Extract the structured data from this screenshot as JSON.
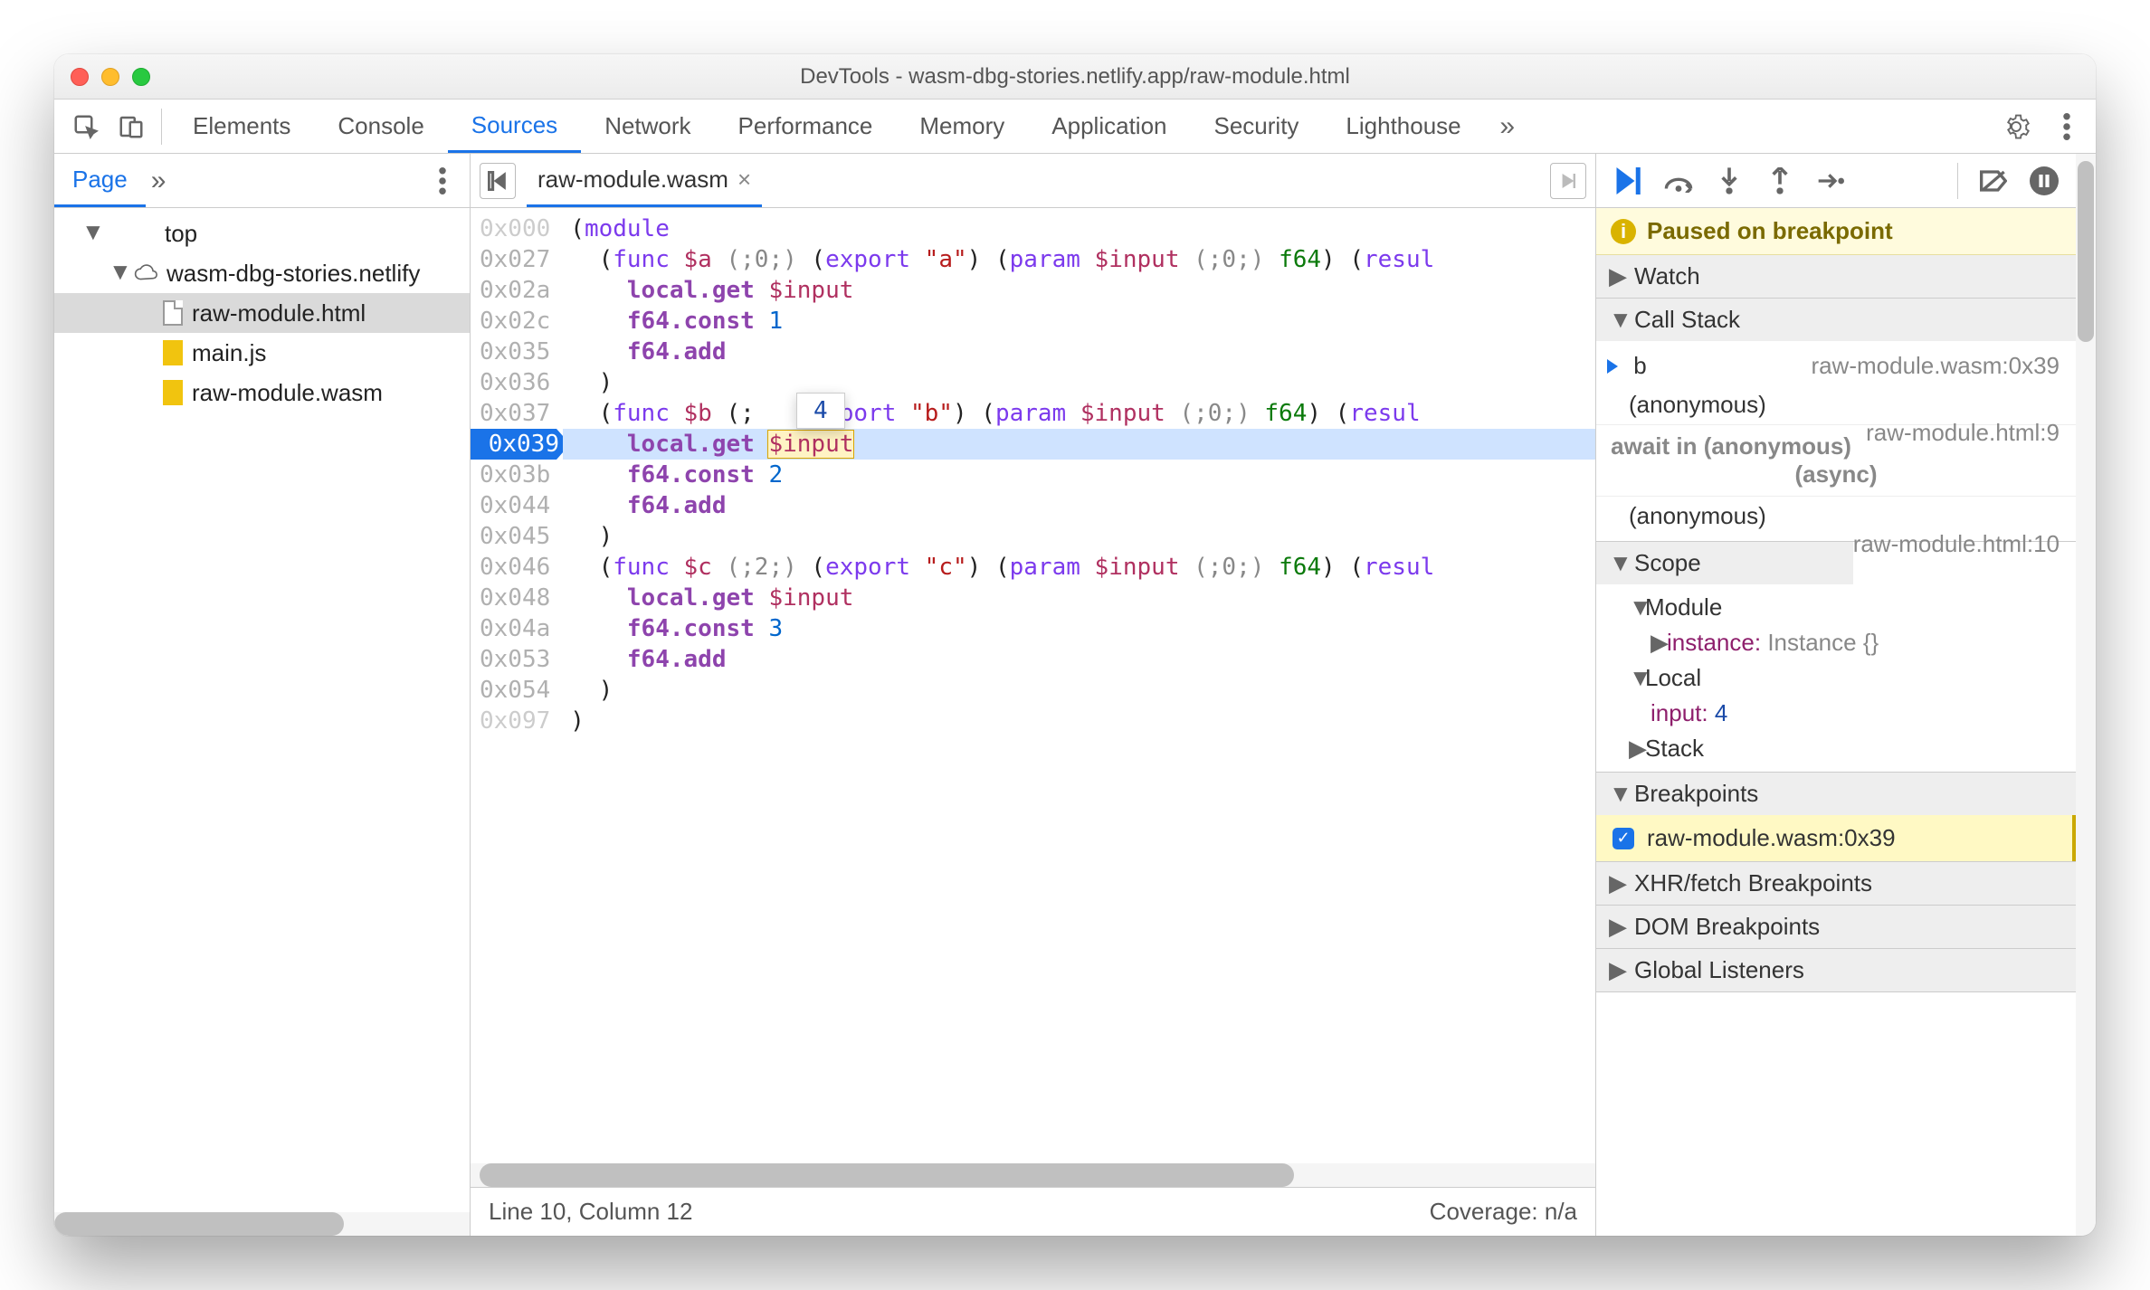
{
  "window_title": "DevTools - wasm-dbg-stories.netlify.app/raw-module.html",
  "tabs": [
    "Elements",
    "Console",
    "Sources",
    "Network",
    "Performance",
    "Memory",
    "Application",
    "Security",
    "Lighthouse"
  ],
  "tabs_active_index": 2,
  "nav": {
    "page_tab": "Page",
    "tree": {
      "top": "top",
      "domain": "wasm-dbg-stories.netlify",
      "files": [
        "raw-module.html",
        "main.js",
        "raw-module.wasm"
      ],
      "selected_index": 0
    }
  },
  "file_tab": {
    "name": "raw-module.wasm"
  },
  "code": {
    "addrs": [
      "0x000",
      "0x027",
      "0x02a",
      "0x02c",
      "0x035",
      "0x036",
      "0x037",
      "0x039",
      "0x03b",
      "0x044",
      "0x045",
      "0x046",
      "0x048",
      "0x04a",
      "0x053",
      "0x054",
      "0x097"
    ],
    "bp_index": 7,
    "bp_addr": "0x039",
    "tooltip_value": "4",
    "lines": [
      [
        [
          "(",
          "p"
        ],
        [
          "module",
          "kw2"
        ]
      ],
      [
        [
          "  (",
          "p"
        ],
        [
          "func",
          "kw2"
        ],
        [
          " ",
          "p"
        ],
        [
          "$a",
          "var"
        ],
        [
          " ",
          "p"
        ],
        [
          "(;0;)",
          "cmt"
        ],
        [
          " (",
          "p"
        ],
        [
          "export",
          "kw2"
        ],
        [
          " ",
          "p"
        ],
        [
          "\"a\"",
          "str"
        ],
        [
          ") (",
          "p"
        ],
        [
          "param",
          "kw2"
        ],
        [
          " ",
          "p"
        ],
        [
          "$input",
          "var"
        ],
        [
          " ",
          "p"
        ],
        [
          "(;0;)",
          "cmt"
        ],
        [
          " ",
          "p"
        ],
        [
          "f64",
          "type"
        ],
        [
          ") (",
          "p"
        ],
        [
          "resul",
          "kw2"
        ]
      ],
      [
        [
          "    ",
          "p"
        ],
        [
          "local.get",
          "kw"
        ],
        [
          " ",
          "p"
        ],
        [
          "$input",
          "var"
        ]
      ],
      [
        [
          "    ",
          "p"
        ],
        [
          "f64.const",
          "kw"
        ],
        [
          " ",
          "p"
        ],
        [
          "1",
          "num"
        ]
      ],
      [
        [
          "    ",
          "p"
        ],
        [
          "f64.add",
          "kw"
        ]
      ],
      [
        [
          "  )",
          "p"
        ]
      ],
      [
        [
          "  (",
          "p"
        ],
        [
          "func",
          "kw2"
        ],
        [
          " ",
          "p"
        ],
        [
          "$b",
          "var"
        ],
        [
          " (;   (",
          "p"
        ],
        [
          "export",
          "kw2"
        ],
        [
          " ",
          "p"
        ],
        [
          "\"b\"",
          "str"
        ],
        [
          ") (",
          "p"
        ],
        [
          "param",
          "kw2"
        ],
        [
          " ",
          "p"
        ],
        [
          "$input",
          "var"
        ],
        [
          " ",
          "p"
        ],
        [
          "(;0;)",
          "cmt"
        ],
        [
          " ",
          "p"
        ],
        [
          "f64",
          "type"
        ],
        [
          ") (",
          "p"
        ],
        [
          "resul",
          "kw2"
        ]
      ],
      [
        [
          "    ",
          "p"
        ],
        [
          "local.get",
          "kw"
        ],
        [
          " ",
          "p"
        ],
        [
          "$input",
          "hlbox var"
        ]
      ],
      [
        [
          "    ",
          "p"
        ],
        [
          "f64.const",
          "kw"
        ],
        [
          " ",
          "p"
        ],
        [
          "2",
          "num"
        ]
      ],
      [
        [
          "    ",
          "p"
        ],
        [
          "f64.add",
          "kw"
        ]
      ],
      [
        [
          "  )",
          "p"
        ]
      ],
      [
        [
          "  (",
          "p"
        ],
        [
          "func",
          "kw2"
        ],
        [
          " ",
          "p"
        ],
        [
          "$c",
          "var"
        ],
        [
          " ",
          "p"
        ],
        [
          "(;2;)",
          "cmt"
        ],
        [
          " (",
          "p"
        ],
        [
          "export",
          "kw2"
        ],
        [
          " ",
          "p"
        ],
        [
          "\"c\"",
          "str"
        ],
        [
          ") (",
          "p"
        ],
        [
          "param",
          "kw2"
        ],
        [
          " ",
          "p"
        ],
        [
          "$input",
          "var"
        ],
        [
          " ",
          "p"
        ],
        [
          "(;0;)",
          "cmt"
        ],
        [
          " ",
          "p"
        ],
        [
          "f64",
          "type"
        ],
        [
          ") (",
          "p"
        ],
        [
          "resul",
          "kw2"
        ]
      ],
      [
        [
          "    ",
          "p"
        ],
        [
          "local.get",
          "kw"
        ],
        [
          " ",
          "p"
        ],
        [
          "$input",
          "var"
        ]
      ],
      [
        [
          "    ",
          "p"
        ],
        [
          "f64.const",
          "kw"
        ],
        [
          " ",
          "p"
        ],
        [
          "3",
          "num"
        ]
      ],
      [
        [
          "    ",
          "p"
        ],
        [
          "f64.add",
          "kw"
        ]
      ],
      [
        [
          "  )",
          "p"
        ]
      ],
      [
        [
          ")",
          "p"
        ]
      ]
    ]
  },
  "status": {
    "left": "Line 10, Column 12",
    "right": "Coverage: n/a"
  },
  "debugger": {
    "paused_msg": "Paused on breakpoint",
    "sections": {
      "watch": "Watch",
      "callstack": "Call Stack",
      "scope": "Scope",
      "breakpoints": "Breakpoints",
      "xhr": "XHR/fetch Breakpoints",
      "dom": "DOM Breakpoints",
      "gl": "Global Listeners"
    },
    "callstack": [
      {
        "fn": "b",
        "loc": "raw-module.wasm:0x39",
        "current": true
      },
      {
        "fn": "(anonymous)",
        "loc": "raw-module.html:9"
      }
    ],
    "async_label": "await in (anonymous) (async)",
    "callstack_after": [
      {
        "fn": "(anonymous)",
        "loc": "raw-module.html:10"
      }
    ],
    "scope": {
      "module_label": "Module",
      "instance_label": "instance:",
      "instance_value": "Instance {}",
      "local_label": "Local",
      "input_key": "input:",
      "input_value": "4",
      "stack_label": "Stack"
    },
    "breakpoints": [
      {
        "label": "raw-module.wasm:0x39",
        "checked": true
      }
    ]
  }
}
